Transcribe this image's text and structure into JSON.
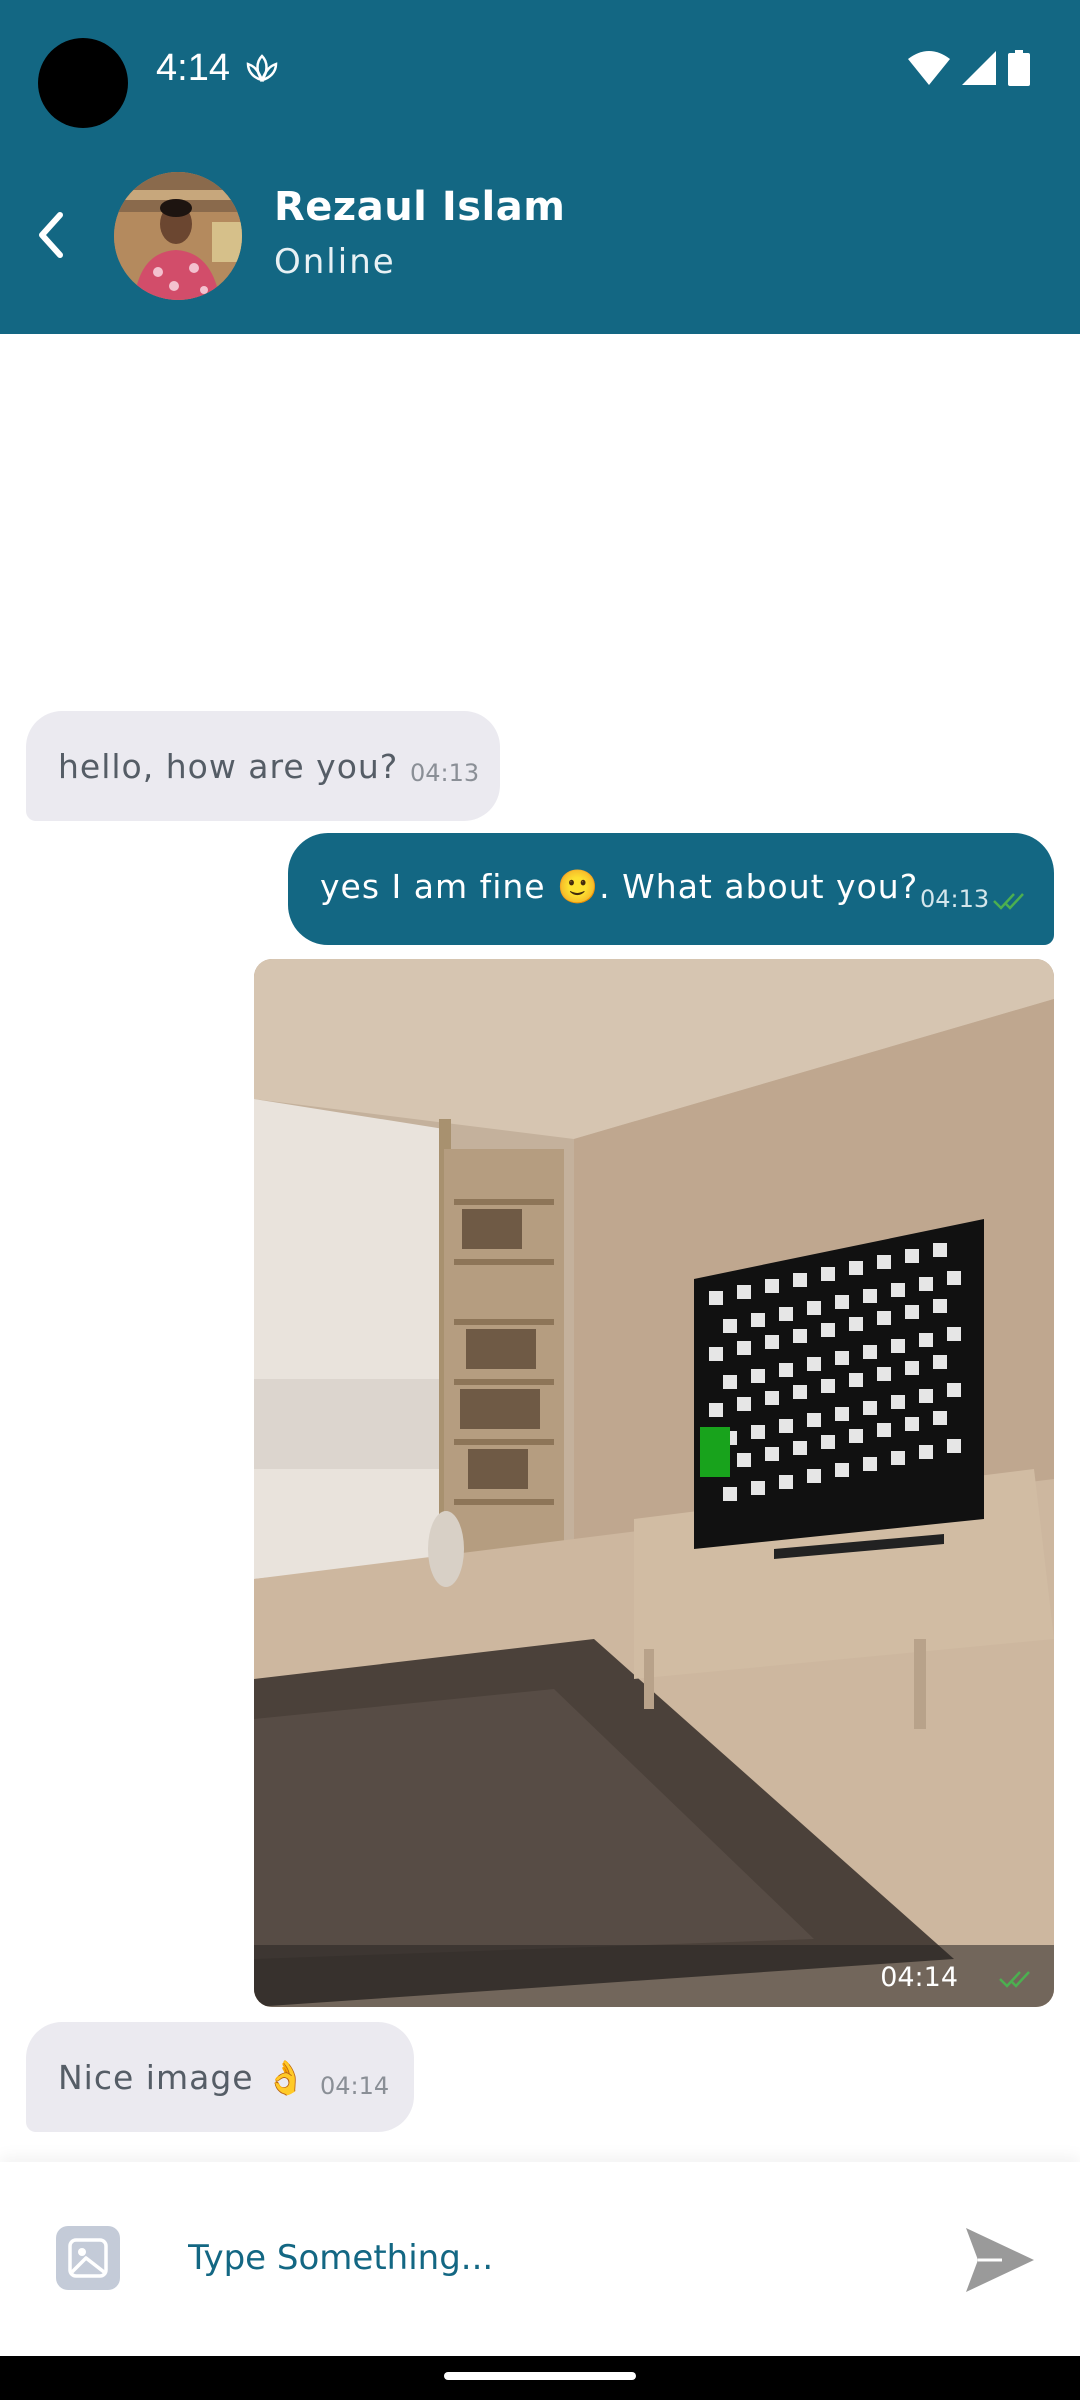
{
  "status_bar": {
    "time": "4:14"
  },
  "header": {
    "name": "Rezaul Islam",
    "status": "Online"
  },
  "messages": [
    {
      "direction": "incoming",
      "text": "hello, how are you?",
      "time": "04:13"
    },
    {
      "direction": "outgoing",
      "text": "yes I am fine 🙂. What about you?",
      "time": "04:13",
      "read": true
    },
    {
      "direction": "outgoing",
      "type": "image",
      "time": "04:14",
      "read": true
    },
    {
      "direction": "incoming",
      "text": "Nice image 👌",
      "time": "04:14"
    }
  ],
  "composer": {
    "placeholder": "Type Something..."
  },
  "colors": {
    "primary": "#136783",
    "incoming_bubble": "#ebeaf0",
    "read_check": "#4caf50"
  },
  "icons": [
    "lotus-icon",
    "wifi-icon",
    "signal-icon",
    "battery-icon",
    "back-icon",
    "double-check-icon",
    "gallery-icon",
    "send-icon"
  ]
}
